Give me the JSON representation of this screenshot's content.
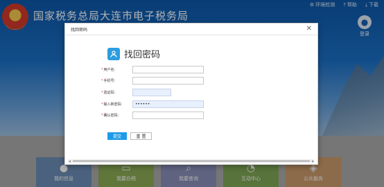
{
  "header": {
    "title": "国家税务总局大连市电子税务局",
    "emblem_label": "大连市税务",
    "topbar": [
      {
        "icon": "gear-icon",
        "glyph": "⚙",
        "label": "环境检测"
      },
      {
        "icon": "help-icon",
        "glyph": "?",
        "label": "帮助"
      },
      {
        "icon": "download-icon",
        "glyph": "⤓",
        "label": "下载"
      }
    ],
    "login_label": "登录"
  },
  "tiles": [
    {
      "label": "我的信息",
      "icon": "user-icon",
      "glyph": "●"
    },
    {
      "label": "我要办税",
      "icon": "monitor-icon",
      "glyph": "▭"
    },
    {
      "label": "我要查询",
      "icon": "search-doc-icon",
      "glyph": "⌕"
    },
    {
      "label": "互动中心",
      "icon": "chat-icon",
      "glyph": "◔"
    },
    {
      "label": "公众服务",
      "icon": "service-icon",
      "glyph": "◈"
    }
  ],
  "modal": {
    "title": "找回密码",
    "heading": "找回密码",
    "fields": {
      "username": {
        "label": "用户名：",
        "value": ""
      },
      "phone": {
        "label": "手机号：",
        "value": ""
      },
      "captcha": {
        "label": "验证码：",
        "value": ""
      },
      "new_password": {
        "label": "输入新密码：",
        "value": "••••••"
      },
      "confirm_password": {
        "label": "确认密码：",
        "value": ""
      }
    },
    "submit_label": "提交",
    "reset_label": "重 置"
  },
  "colors": {
    "header_blue": "#1b6fc4",
    "accent": "#1e9be8",
    "required": "#dd3333"
  }
}
